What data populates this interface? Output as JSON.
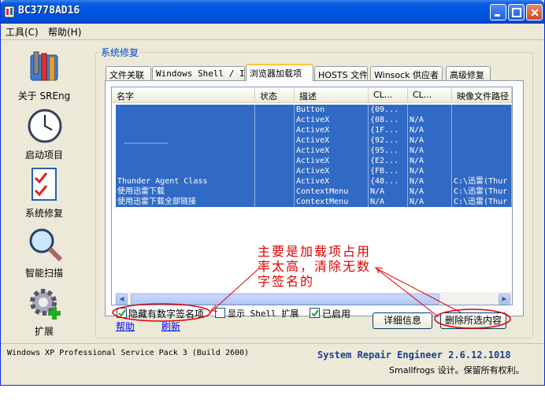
{
  "window": {
    "title": "BC3778AD16"
  },
  "menu": {
    "tools": "工具(C)",
    "help": "帮助(H)"
  },
  "sidebar": {
    "items": [
      {
        "label": "关于 SREng",
        "icon": "tools-icon"
      },
      {
        "label": "启动项目",
        "icon": "clock-icon"
      },
      {
        "label": "系统修复",
        "icon": "checklist-icon"
      },
      {
        "label": "智能扫描",
        "icon": "magnifier-icon"
      },
      {
        "label": "扩展",
        "icon": "gear-plus-icon"
      }
    ]
  },
  "group": {
    "title": "系统修复"
  },
  "tabs": [
    "文件关联",
    "Windows Shell / IE",
    "浏览器加载项",
    "HOSTS 文件",
    "Winsock 供应者",
    "高级修复"
  ],
  "table": {
    "columns": [
      "名字",
      "状态",
      "描述",
      "CL...",
      "CL...",
      "映像文件路径"
    ],
    "rows": [
      [
        "",
        "",
        "Button",
        "{09...",
        "",
        ""
      ],
      [
        "",
        "",
        "ActiveX",
        "{08...",
        "N/A",
        ""
      ],
      [
        "",
        "",
        "ActiveX",
        "{1F...",
        "N/A",
        ""
      ],
      [
        "",
        "",
        "ActiveX",
        "{92...",
        "N/A",
        ""
      ],
      [
        "",
        "",
        "ActiveX",
        "{95...",
        "N/A",
        ""
      ],
      [
        "",
        "",
        "ActiveX",
        "{E2...",
        "N/A",
        ""
      ],
      [
        "",
        "",
        "ActiveX",
        "{FB...",
        "N/A",
        ""
      ],
      [
        "Thunder Agent Class",
        "",
        "ActiveX",
        "{48...",
        "N/A",
        "C:\\迅雷(Thur"
      ],
      [
        "使用迅雷下载",
        "",
        "ContextMenu",
        "N/A",
        "N/A",
        "C:\\迅雷(Thur"
      ],
      [
        "使用迅雷下载全部链接",
        "",
        "ContextMenu",
        "N/A",
        "N/A",
        "C:\\迅雷(Thur"
      ]
    ]
  },
  "options": {
    "hide_signed": "隐藏有数字签名项",
    "show_shell": "显示 Shell 扩展",
    "enabled": "已启用",
    "hide_signed_checked": true,
    "show_shell_checked": false,
    "enabled_checked": true
  },
  "links": {
    "help": "帮助",
    "refresh": "刷新"
  },
  "buttons": {
    "details": "详细信息",
    "delete": "删除所选内容"
  },
  "annotation": "主要是加载项占用\n率太高，清除无数\n字签名的",
  "status": {
    "os": "Windows XP Professional Service Pack 3 (Build 2600)",
    "product": "System Repair Engineer 2.6.12.1018",
    "copyright": "Smallfrogs 设计。保留所有权利。"
  },
  "colors": {
    "selection": "#316ac5",
    "titlebar": "#0054e3",
    "annotation": "#e00000"
  }
}
